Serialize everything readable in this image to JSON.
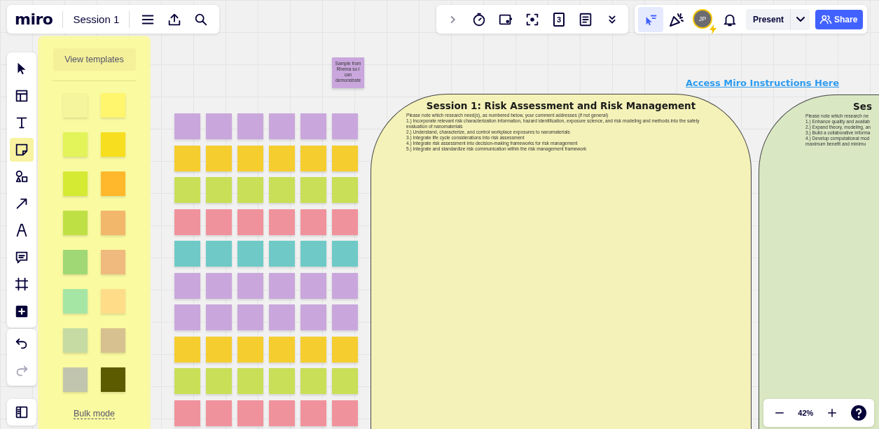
{
  "board_header": {
    "logo": "miro",
    "board_name": "Session 1"
  },
  "collaboration_toolbar": {
    "tools": [
      {
        "kind": "chevron"
      },
      {
        "kind": "timer"
      },
      {
        "kind": "card"
      },
      {
        "kind": "focus"
      },
      {
        "kind": "vote",
        "label": "3"
      },
      {
        "kind": "notes"
      },
      {
        "kind": "more"
      }
    ]
  },
  "user_toolbar": {
    "reactions_selected": true,
    "avatar_initials": "JP",
    "present_label": "Present",
    "share_label": "Share"
  },
  "left_toolbar": {
    "tools": [
      {
        "kind": "select",
        "selected": false
      },
      {
        "kind": "templates",
        "selected": false
      },
      {
        "kind": "text",
        "selected": false
      },
      {
        "kind": "sticky",
        "selected": true
      },
      {
        "kind": "shapes",
        "selected": false
      },
      {
        "kind": "arrow",
        "selected": false
      },
      {
        "kind": "pen",
        "selected": false
      },
      {
        "kind": "comment",
        "selected": false
      },
      {
        "kind": "frame",
        "selected": false
      },
      {
        "kind": "add",
        "selected": false
      }
    ],
    "history": [
      {
        "kind": "undo",
        "disabled": false
      },
      {
        "kind": "redo",
        "disabled": true
      }
    ]
  },
  "sticky_panel": {
    "view_templates": "View templates",
    "bulk_mode": "Bulk mode",
    "colors": [
      {
        "color": "#f5f59e"
      },
      {
        "color": "#fff66d"
      },
      {
        "color": "#e2f45a"
      },
      {
        "color": "#f7de1e"
      },
      {
        "color": "#d4ea33"
      },
      {
        "color": "#ffb72b"
      },
      {
        "color": "#bfe045"
      },
      {
        "color": "#f2b76b"
      },
      {
        "color": "#9fd875"
      },
      {
        "color": "#f0b97d"
      },
      {
        "color": "#a5e6a5"
      },
      {
        "color": "#ffdd88"
      },
      {
        "color": "#c6dba3"
      },
      {
        "color": "#d8c190"
      },
      {
        "color": "#c1c5ad"
      },
      {
        "color": "#5c5b00"
      }
    ]
  },
  "sample_note": {
    "text": "Sample from Rhema so I can demonstrate",
    "color": "#c9a7dc"
  },
  "sticky_grid": {
    "rows": [
      {
        "notes": [
          {
            "color": "#c9a7dc"
          },
          {
            "color": "#c9a7dc"
          },
          {
            "color": "#c9a7dc"
          },
          {
            "color": "#c9a7dc"
          },
          {
            "color": "#c9a7dc"
          },
          {
            "color": "#c9a7dc"
          }
        ]
      },
      {
        "notes": [
          {
            "color": "#f5cd2f"
          },
          {
            "color": "#f5cd2f"
          },
          {
            "color": "#f5cd2f"
          },
          {
            "color": "#f5cd2f"
          },
          {
            "color": "#f5cd2f"
          },
          {
            "color": "#f5cd2f"
          }
        ]
      },
      {
        "notes": [
          {
            "color": "#c8df57"
          },
          {
            "color": "#c8df57"
          },
          {
            "color": "#c8df57"
          },
          {
            "color": "#c8df57"
          },
          {
            "color": "#c8df57"
          },
          {
            "color": "#c8df57"
          }
        ]
      },
      {
        "notes": [
          {
            "color": "#f0929c"
          },
          {
            "color": "#f0929c"
          },
          {
            "color": "#f0929c"
          },
          {
            "color": "#f0929c"
          },
          {
            "color": "#f0929c"
          },
          {
            "color": "#f0929c"
          }
        ]
      },
      {
        "notes": [
          {
            "color": "#6fcac7"
          },
          {
            "color": "#6fcac7"
          },
          {
            "color": "#6fcac7"
          },
          {
            "color": "#6fcac7"
          },
          {
            "color": "#6fcac7"
          },
          {
            "color": "#6fcac7"
          }
        ]
      },
      {
        "notes": [
          {
            "color": "#c9a7dc"
          },
          {
            "color": "#c9a7dc"
          },
          {
            "color": "#c9a7dc"
          },
          {
            "color": "#c9a7dc"
          },
          {
            "color": "#c9a7dc"
          },
          {
            "color": "#c9a7dc"
          }
        ]
      },
      {
        "notes": [
          {
            "color": "#c9a7dc"
          },
          {
            "color": "#c9a7dc"
          },
          {
            "color": "#c9a7dc"
          },
          {
            "color": "#c9a7dc"
          },
          {
            "color": "#c9a7dc"
          },
          {
            "color": "#c9a7dc"
          }
        ]
      },
      {
        "notes": [
          {
            "color": "#f5cd2f"
          },
          {
            "color": "#f5cd2f"
          },
          {
            "color": "#f5cd2f"
          },
          {
            "color": "#f5cd2f"
          },
          {
            "color": "#f5cd2f"
          },
          {
            "color": "#f5cd2f"
          }
        ]
      },
      {
        "notes": [
          {
            "color": "#c8df57"
          },
          {
            "color": "#c8df57"
          },
          {
            "color": "#c8df57"
          },
          {
            "color": "#c8df57"
          },
          {
            "color": "#c8df57"
          },
          {
            "color": "#c8df57"
          }
        ]
      },
      {
        "notes": [
          {
            "color": "#f0929c"
          },
          {
            "color": "#f0929c"
          },
          {
            "color": "#f0929c"
          },
          {
            "color": "#f0929c"
          },
          {
            "color": "#f0929c"
          },
          {
            "color": "#f0929c"
          }
        ]
      }
    ]
  },
  "instructions_link": "Access Miro Instructions Here",
  "frames": [
    {
      "kind": "yellow",
      "title": "Session 1: Risk Assessment and Risk Management",
      "lines": [
        "Please note which research need(s), as numbered below, your comment addresses (if not general)",
        "1.) Incorporate relevant risk characterization information, hazard identification, exposure science, and risk modeling and methods into the safety evaluation of nanomaterials",
        "2.) Understand, characterize, and control workplace exposures to nanomaterials",
        "3.) Integrate life cycle considerations into risk assessment",
        "4.) Integrate risk assessment into decision-making frameworks for risk management",
        "5.) Integrate and standardize risk communication within the risk management framework"
      ]
    },
    {
      "kind": "green",
      "title": "Ses",
      "lines": [
        "Please note which research ne",
        "1.) Enhance quality and availab",
        "2.) Expand theory, modeling, an",
        "3.) Build a collaborative informa",
        "4.) Develop computational mod",
        "maximum benefit and minimu"
      ]
    }
  ],
  "zoom_control": {
    "zoom_label": "42%"
  }
}
